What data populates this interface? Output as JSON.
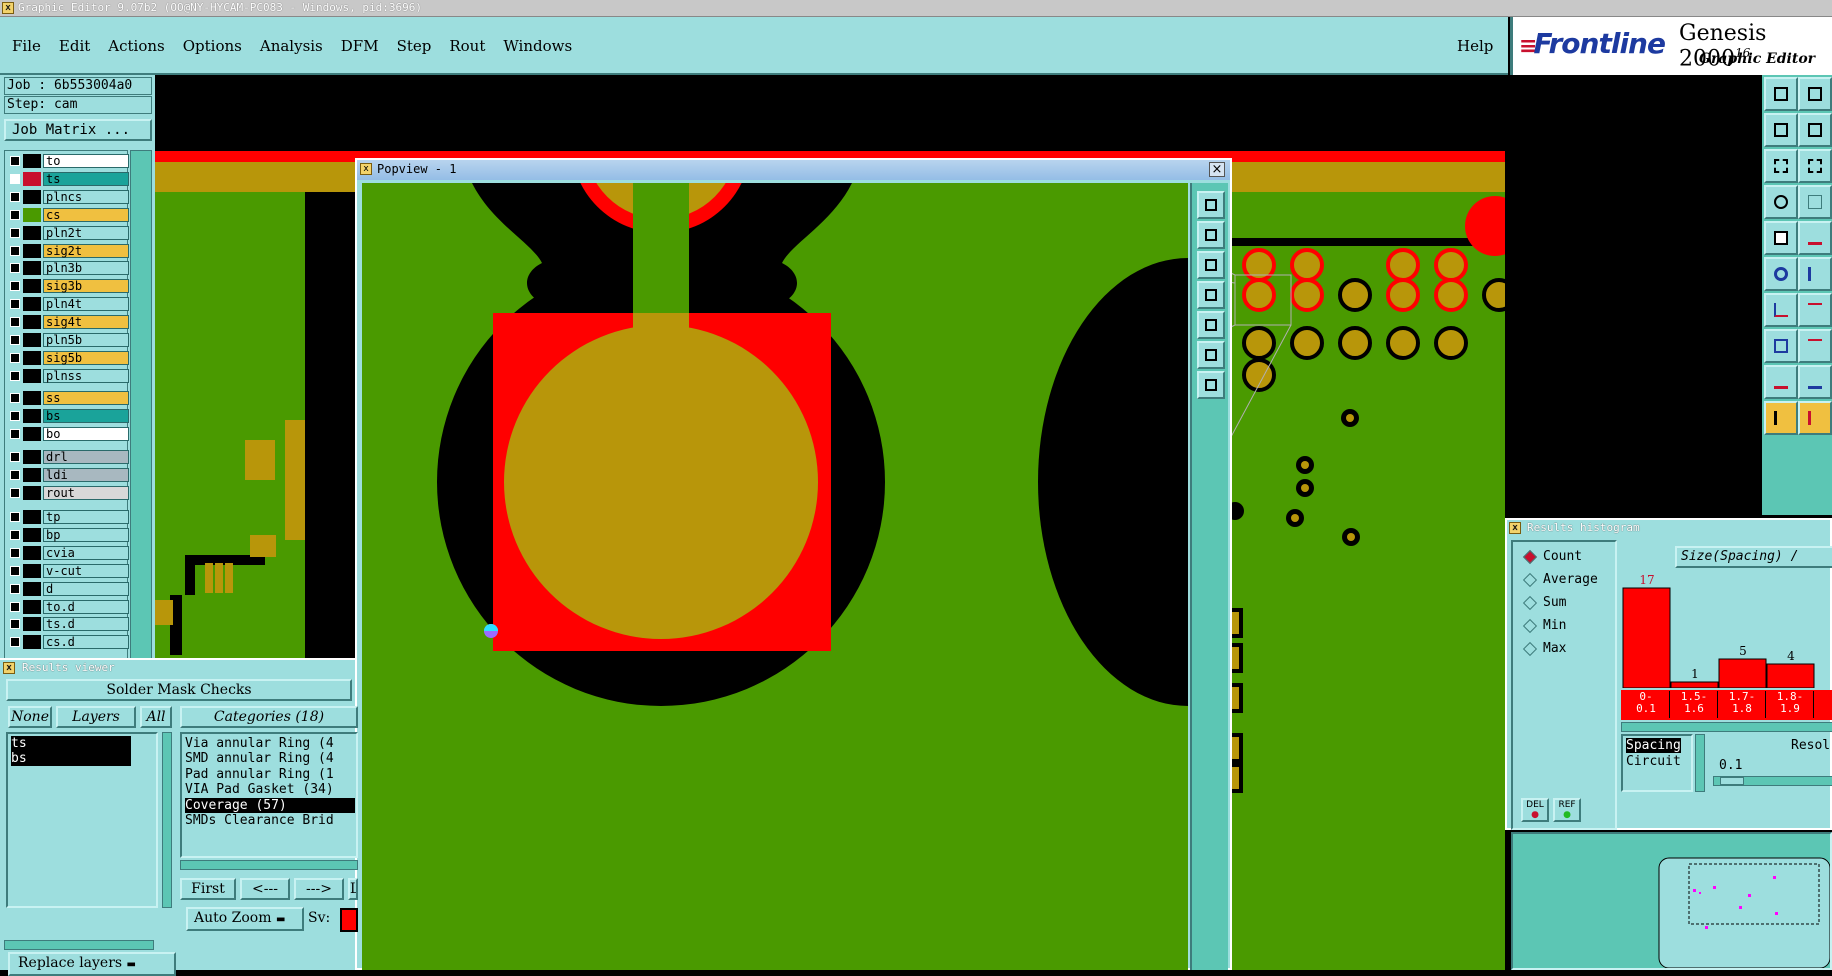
{
  "window_title": "Graphic Editor 9.07b2 (OO@NY-HYCAM-PC083 - Windows, pid:3696)",
  "menu": [
    "File",
    "Edit",
    "Actions",
    "Options",
    "Analysis",
    "DFM",
    "Step",
    "Rout",
    "Windows"
  ],
  "help": "Help",
  "brand": {
    "logo_pre": "F",
    "logo_rest": "rontline",
    "product": "Genesis 2000",
    "version_sup": "16",
    "subtitle": "Graphic Editor"
  },
  "job_label": "Job : 6b553004a0",
  "step_label": "Step: cam",
  "job_matrix": "Job Matrix ...",
  "layers": [
    {
      "name": "to",
      "color": "#ffffff",
      "sw": "#000000",
      "active": false
    },
    {
      "name": "ts",
      "color": "#1aa39a",
      "sw": "#c8102e",
      "active": true
    },
    {
      "name": "plncs",
      "color": "#9ddede",
      "sw": "#000000",
      "active": false
    },
    {
      "name": "cs",
      "color": "#f0c040",
      "sw": "#4a9a00",
      "active": false
    },
    {
      "name": "pln2t",
      "color": "#9ddede",
      "sw": "#000000",
      "active": false
    },
    {
      "name": "sig2t",
      "color": "#f0c040",
      "sw": "#000000",
      "active": false
    },
    {
      "name": "pln3b",
      "color": "#9ddede",
      "sw": "#000000",
      "active": false
    },
    {
      "name": "sig3b",
      "color": "#f0c040",
      "sw": "#000000",
      "active": false
    },
    {
      "name": "pln4t",
      "color": "#9ddede",
      "sw": "#000000",
      "active": false
    },
    {
      "name": "sig4t",
      "color": "#f0c040",
      "sw": "#000000",
      "active": false
    },
    {
      "name": "pln5b",
      "color": "#9ddede",
      "sw": "#000000",
      "active": false
    },
    {
      "name": "sig5b",
      "color": "#f0c040",
      "sw": "#000000",
      "active": false
    },
    {
      "name": "plnss",
      "color": "#9ddede",
      "sw": "#000000",
      "active": false
    },
    {
      "name": "ss",
      "color": "#f0c040",
      "sw": "#000000",
      "active": false
    },
    {
      "name": "bs",
      "color": "#1aa39a",
      "sw": "#000000",
      "active": false
    },
    {
      "name": "bo",
      "color": "#ffffff",
      "sw": "#000000",
      "active": false
    },
    {
      "name": "drl",
      "color": "#a8b8c0",
      "sw": "#000000",
      "active": false
    },
    {
      "name": "ldi",
      "color": "#a8b8c0",
      "sw": "#000000",
      "active": false
    },
    {
      "name": "rout",
      "color": "#d8d8d8",
      "sw": "#000000",
      "active": false
    },
    {
      "name": "tp",
      "color": "#9ddede",
      "sw": "#000000",
      "active": false
    },
    {
      "name": "bp",
      "color": "#9ddede",
      "sw": "#000000",
      "active": false
    },
    {
      "name": "cvia",
      "color": "#9ddede",
      "sw": "#000000",
      "active": false
    },
    {
      "name": "v-cut",
      "color": "#9ddede",
      "sw": "#000000",
      "active": false
    },
    {
      "name": "d",
      "color": "#9ddede",
      "sw": "#000000",
      "active": false
    },
    {
      "name": "to.d",
      "color": "#9ddede",
      "sw": "#000000",
      "active": false
    },
    {
      "name": "ts.d",
      "color": "#9ddede",
      "sw": "#000000",
      "active": false
    },
    {
      "name": "cs.d",
      "color": "#9ddede",
      "sw": "#000000",
      "active": false
    }
  ],
  "popview_title": "Popview - 1",
  "results_viewer": {
    "title": "Results viewer",
    "check_name": "Solder Mask Checks",
    "none_label": "None",
    "layers_label": "Layers",
    "all_label": "All",
    "categories_label": "Categories (18)",
    "selected_layers": [
      "ts",
      "bs"
    ],
    "categories": [
      "Via annular Ring (4",
      "SMD annular Ring (4",
      "Pad annular Ring (1",
      "VIA Pad Gasket (34)",
      "Coverage (57)",
      "SMDs Clearance Brid"
    ],
    "selected_category": "Coverage (57)",
    "first": "First",
    "prev": "<---",
    "next": "--->",
    "last": "La",
    "auto_zoom": "Auto Zoom",
    "sv_label": "Sv:",
    "replace_layers": "Replace layers"
  },
  "histogram": {
    "title": "Results histogram",
    "options": [
      "Count",
      "Average",
      "Sum",
      "Min",
      "Max"
    ],
    "selected": "Count",
    "size_label": "Size(Spacing) /",
    "bars": [
      {
        "range": "0-\n0.1",
        "value": 17
      },
      {
        "range": "1.5-\n1.6",
        "value": 1
      },
      {
        "range": "1.7-\n1.8",
        "value": 5
      },
      {
        "range": "1.8-\n1.9",
        "value": 4
      }
    ],
    "del_label": "DEL",
    "ref_label": "REF",
    "type_list": [
      "Spacing",
      "Circuit"
    ],
    "reso_label": "Resol",
    "reso_value": "0.1"
  }
}
